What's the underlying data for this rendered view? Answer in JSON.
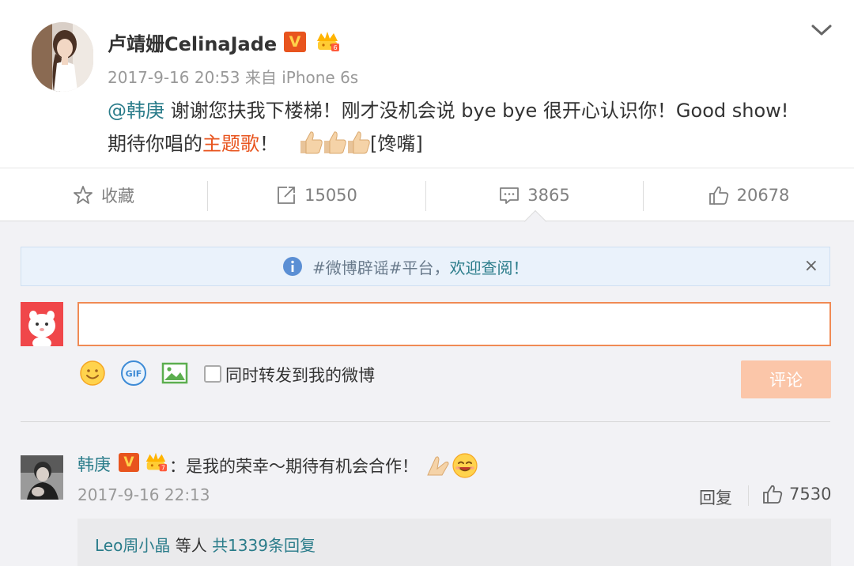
{
  "post": {
    "author": "卢靖姗CelinaJade",
    "verified_badge": "V",
    "time": "2017-9-16 20:53",
    "source": "来自 iPhone 6s",
    "mention": "@韩庚",
    "text_line1": " 谢谢您扶我下楼梯！刚才没机会说 bye bye 很开心认识你！Good show!",
    "text_line2_start": "期待你唱的",
    "topic": "主题歌",
    "text_line2_mid": "！",
    "text_line2_end": "[馋嘴]"
  },
  "actions": {
    "favorite": "收藏",
    "repost": "15050",
    "comment": "3865",
    "like": "20678"
  },
  "notice": {
    "text": "#微博辟谣#平台，",
    "link": "欢迎查阅！",
    "close": "×"
  },
  "composer": {
    "placeholder": "",
    "repost_label": "同时转发到我的微博",
    "submit": "评论"
  },
  "comments": [
    {
      "author": "韩庚",
      "verified_badge": "V",
      "text": "：是我的荣幸～期待有机会合作！",
      "time": "2017-9-16 22:13",
      "reply": "回复",
      "likes": "7530",
      "sub": {
        "name": "Leo周小晶",
        "etc": " 等人 ",
        "count": "共1339条回复"
      }
    }
  ],
  "colors": {
    "link": "#2a7c8a",
    "topic": "#e8541e",
    "submit_bg": "#fbc6a9",
    "input_border": "#f08a54"
  }
}
